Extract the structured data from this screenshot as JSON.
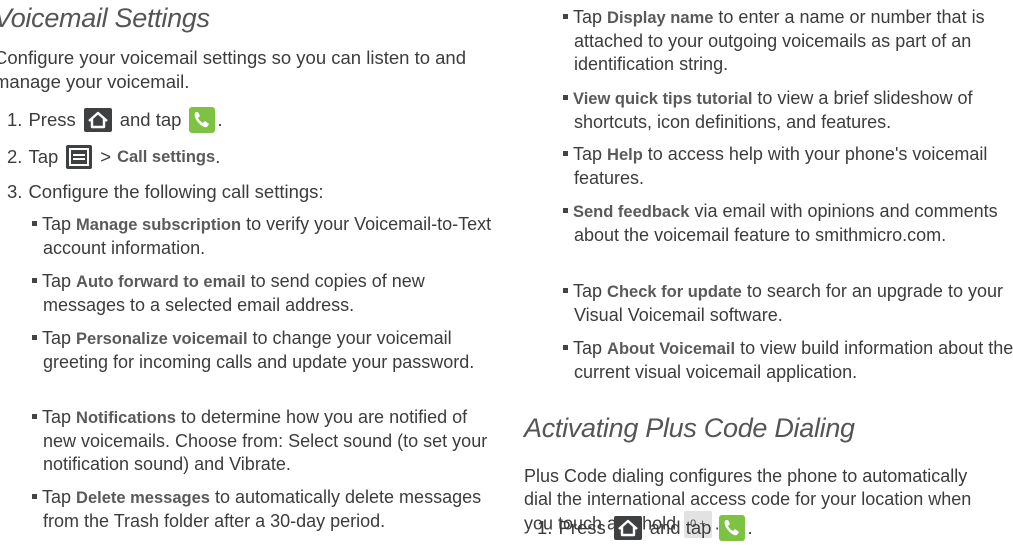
{
  "left": {
    "title": "Voicemail Settings",
    "intro": "Configure your voicemail settings so you can listen to and manage your voicemail.",
    "steps": [
      {
        "num": "1.",
        "pre": "Press",
        "mid": "and tap",
        "post": "."
      },
      {
        "num": "2.",
        "pre": "Tap",
        "sep": ">",
        "target": "Call settings",
        "post": "."
      },
      {
        "num": "3.",
        "text": "Configure the following call settings:"
      }
    ],
    "bullets": [
      {
        "pre": "Tap ",
        "bold": "Manage subscription",
        "rest": " to verify your Voicemail-to-Text account information."
      },
      {
        "pre": "Tap ",
        "bold": "Auto forward to email",
        "rest": " to send copies of new messages to a selected email address."
      },
      {
        "pre": "Tap ",
        "bold": "Personalize voicemail",
        "rest": " to change your voicemail greeting for incoming calls and update your password."
      },
      {
        "pre": "Tap ",
        "bold": "Notifications",
        "rest": " to determine how you are notified of new voicemails. Choose from: Select sound (to set your notification sound) and Vibrate."
      },
      {
        "pre": "Tap ",
        "bold": "Delete messages",
        "rest": " to automatically delete messages from the Trash folder after a 30-day period."
      }
    ]
  },
  "right": {
    "bullets": [
      {
        "pre": "Tap ",
        "bold": "Display name",
        "rest": " to enter a name or number that is attached to your outgoing voicemails as part of an identification string."
      },
      {
        "pre": "",
        "bold": "View quick tips tutorial",
        "rest": " to view a brief slideshow of shortcuts, icon definitions, and features."
      },
      {
        "pre": "Tap ",
        "bold": "Help",
        "rest": " to access help with your phone's voicemail features."
      },
      {
        "pre": "",
        "bold": "Send feedback",
        "rest": " via email with opinions and comments about the voicemail feature to smithmicro.com."
      },
      {
        "pre": "Tap ",
        "bold": "Check for update",
        "rest": " to search for an upgrade to your Visual Voicemail software."
      },
      {
        "pre": "Tap ",
        "bold": "About Voicemail",
        "rest": " to view build information about the current visual voicemail application."
      }
    ],
    "title": "Activating Plus Code Dialing",
    "intro_pre": "Plus Code dialing configures the phone to automatically dial the international access code for your location when you touch and hold",
    "key": "0 +",
    "intro_post": ".",
    "step1": {
      "num": "1.",
      "pre": "Press",
      "mid": "and tap",
      "post": "."
    }
  },
  "icons": {
    "home": "home-icon",
    "phone": "phone-icon",
    "menu": "menu-icon"
  },
  "colors": {
    "phone_icon": "#7dc243",
    "dark_icon": "#3f4041"
  }
}
